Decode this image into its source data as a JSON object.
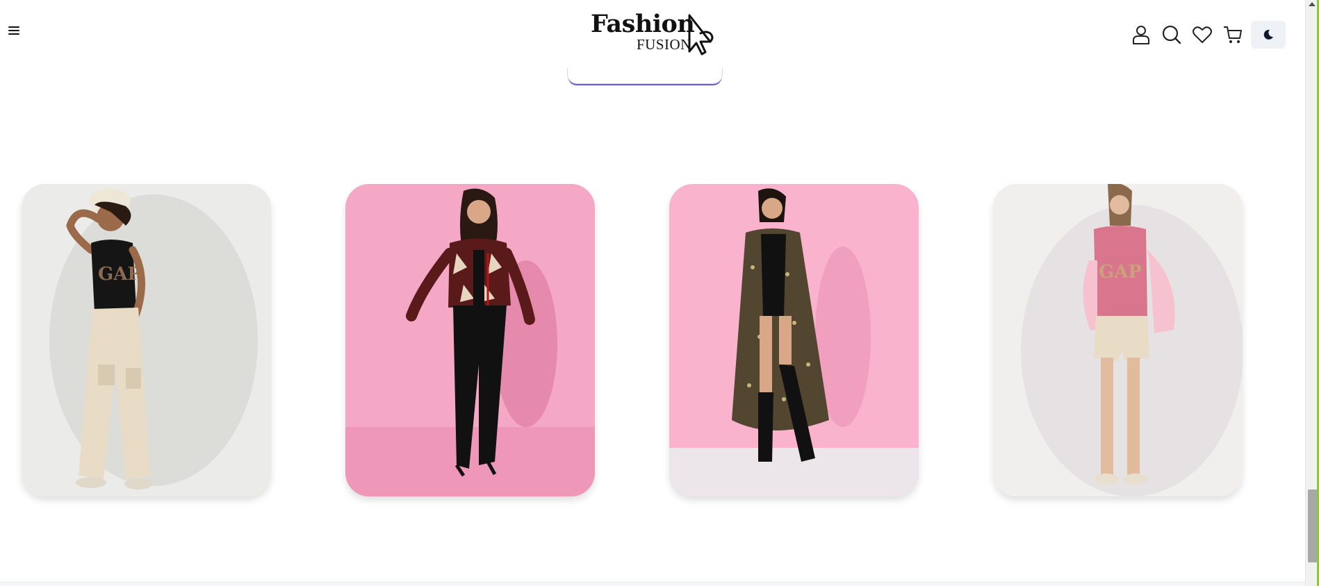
{
  "header": {
    "menu_icon": "hamburger-icon",
    "logo": {
      "word": "Fashion",
      "sub": "FUSION",
      "icon": "hanger-cursor-icon"
    },
    "icons": [
      "user-icon",
      "search-icon",
      "heart-icon",
      "cart-icon"
    ],
    "theme_icon": "moon-icon"
  },
  "products": [
    {
      "background": "#ebebe9",
      "top_color": "#151515",
      "bottom_color": "#e8dcc6",
      "pose": "cargo-pants-hat"
    },
    {
      "background": "#f5a8c6",
      "top_color": "#5a1a1a",
      "bottom_color": "#111111",
      "pose": "printed-jacket-jeans"
    },
    {
      "background": "#f9b3cd",
      "top_color": "#3f3a20",
      "bottom_color": "#111111",
      "pose": "floral-shrug-boots"
    },
    {
      "background": "#f1eeee",
      "top_color": "#d9768e",
      "bottom_color": "#e8dcc6",
      "pose": "pink-tee-shorts"
    }
  ],
  "colors": {
    "accent": "#6b5bd6",
    "scroll_accent": "#8dc63f"
  }
}
